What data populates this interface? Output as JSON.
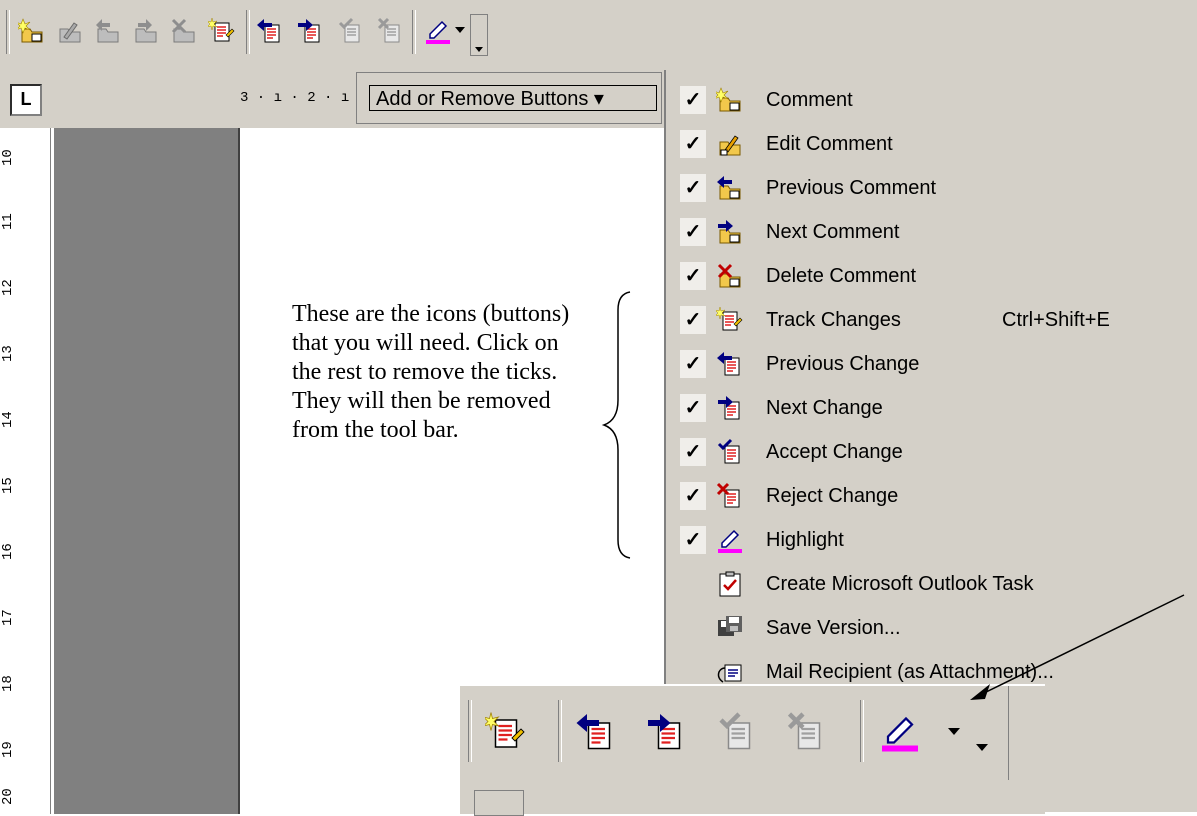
{
  "toolbar": {
    "icons": [
      "insert-comment-icon",
      "edit-comment-icon",
      "previous-comment-icon",
      "next-comment-icon",
      "delete-comment-icon",
      "track-changes-icon",
      "previous-change-icon",
      "next-change-icon",
      "accept-change-icon",
      "reject-change-icon",
      "highlight-icon",
      "dropdown-arrow-icon",
      "toolbar-options-icon"
    ]
  },
  "ruler": {
    "corner": "L",
    "horizontal_fragment": "3 · ı · 2 · ı",
    "vertical_labels": [
      "10",
      "11",
      "12",
      "13",
      "14",
      "15",
      "16",
      "17",
      "18",
      "19",
      "20"
    ]
  },
  "add_remove": {
    "label": "Add or Remove Buttons ▾"
  },
  "menu": {
    "items": [
      {
        "label": "Comment",
        "checked": true,
        "icon": "insert-comment-icon"
      },
      {
        "label": "Edit Comment",
        "checked": true,
        "icon": "edit-comment-icon"
      },
      {
        "label": "Previous Comment",
        "checked": true,
        "icon": "previous-comment-icon"
      },
      {
        "label": "Next Comment",
        "checked": true,
        "icon": "next-comment-icon"
      },
      {
        "label": "Delete Comment",
        "checked": true,
        "icon": "delete-comment-icon"
      },
      {
        "label": "Track Changes",
        "accel": "Ctrl+Shift+E",
        "checked": true,
        "icon": "track-changes-icon"
      },
      {
        "label": "Previous Change",
        "checked": true,
        "icon": "previous-change-icon"
      },
      {
        "label": "Next Change",
        "checked": true,
        "icon": "next-change-icon"
      },
      {
        "label": "Accept Change",
        "checked": true,
        "icon": "accept-change-icon"
      },
      {
        "label": "Reject Change",
        "checked": true,
        "icon": "reject-change-icon"
      },
      {
        "label": "Highlight",
        "checked": true,
        "icon": "highlight-icon"
      },
      {
        "label": "Create Microsoft Outlook Task",
        "checked": false,
        "icon": "outlook-task-icon"
      },
      {
        "label": "Save Version...",
        "checked": false,
        "icon": "save-version-icon"
      },
      {
        "label": "Mail Recipient (as Attachment)...",
        "checked": false,
        "icon": "mail-recipient-icon"
      }
    ],
    "check_glyph": "✓"
  },
  "annotation": {
    "text": "These are the icons (buttons) that you will need.  Click on the rest to remove the ticks.  They will then be removed from the tool bar."
  },
  "colors": {
    "face": "#d4d0c8",
    "shadow": "#808080",
    "highlight_pink": "#ff00ff",
    "navy": "#000080"
  }
}
